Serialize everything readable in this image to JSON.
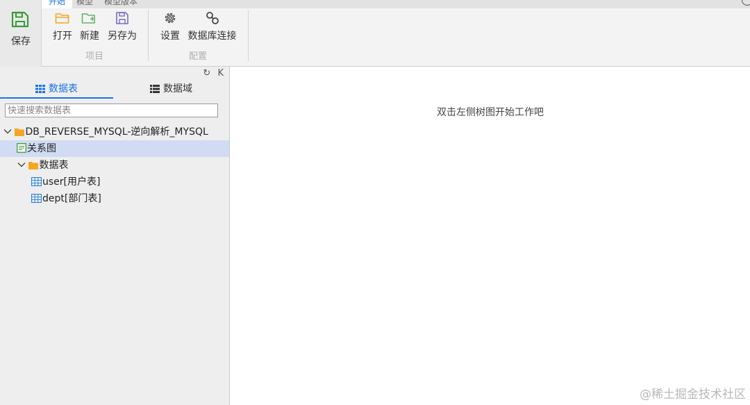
{
  "ribbon": {
    "tabs": [
      "开始",
      "模型",
      "模型版本"
    ],
    "save_label": "保存",
    "project_group": {
      "label": "项目",
      "buttons": [
        "打开",
        "新建",
        "另存为"
      ]
    },
    "config_group": {
      "label": "配置",
      "buttons": [
        "设置",
        "数据库连接"
      ]
    }
  },
  "left_panel": {
    "tools": {
      "refresh": "↻",
      "collapse": "K"
    },
    "tabs": {
      "tables": "数据表",
      "domains": "数据域"
    },
    "search_placeholder": "快速搜索数据表",
    "tree": {
      "root": "DB_REVERSE_MYSQL-逆向解析_MYSQL",
      "diagram": "关系图",
      "tables_folder": "数据表",
      "tables": [
        "user[用户表]",
        "dept[部门表]"
      ]
    }
  },
  "main": {
    "hint": "双击左侧树图开始工作吧"
  },
  "watermark": "@稀土掘金技术社区",
  "colors": {
    "accent": "#1a73e8",
    "folder": "#f5a623",
    "save_icon": "#3a9a3a",
    "selection": "#cfdcf3"
  }
}
